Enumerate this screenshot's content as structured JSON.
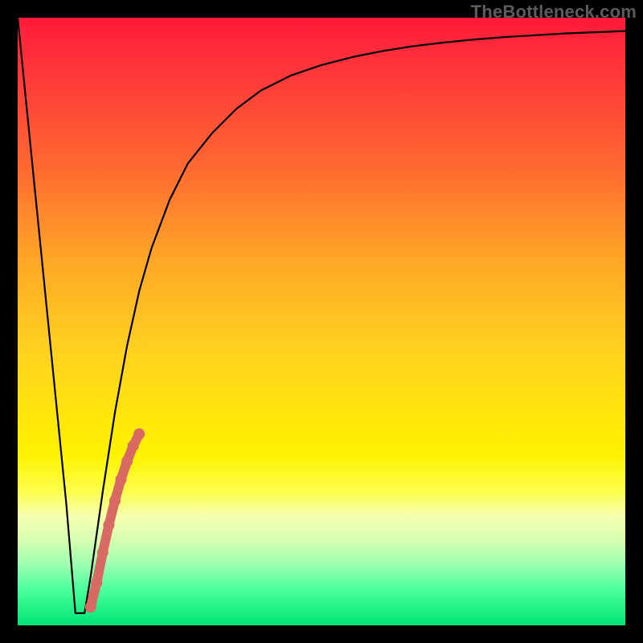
{
  "watermark": "TheBottleneck.com",
  "chart_data": {
    "type": "line",
    "title": "",
    "xlabel": "",
    "ylabel": "",
    "xlim": [
      0,
      100
    ],
    "ylim": [
      0,
      100
    ],
    "series": [
      {
        "name": "bottleneck-curve",
        "x": [
          0,
          2,
          4,
          6,
          8,
          9.5,
          11,
          12,
          14,
          16,
          18,
          20,
          22,
          25,
          28,
          32,
          36,
          40,
          45,
          50,
          55,
          60,
          65,
          70,
          75,
          80,
          85,
          90,
          95,
          100
        ],
        "y": [
          100,
          80,
          60,
          40,
          20,
          2,
          2,
          8,
          22,
          35,
          46,
          55,
          62,
          70,
          76,
          81,
          85,
          88,
          90.5,
          92.2,
          93.5,
          94.5,
          95.3,
          95.9,
          96.4,
          96.8,
          97.1,
          97.4,
          97.6,
          97.8
        ]
      },
      {
        "name": "highlight-segment",
        "x": [
          12.0,
          13.0,
          14.0,
          15.0,
          16.0,
          17.0,
          18.0,
          19.0,
          20.0
        ],
        "y": [
          3.0,
          7.0,
          12.0,
          16.5,
          20.5,
          24.0,
          27.0,
          29.5,
          31.5
        ]
      }
    ],
    "colors": {
      "curve": "#000000",
      "highlight": "#d96a63"
    }
  }
}
